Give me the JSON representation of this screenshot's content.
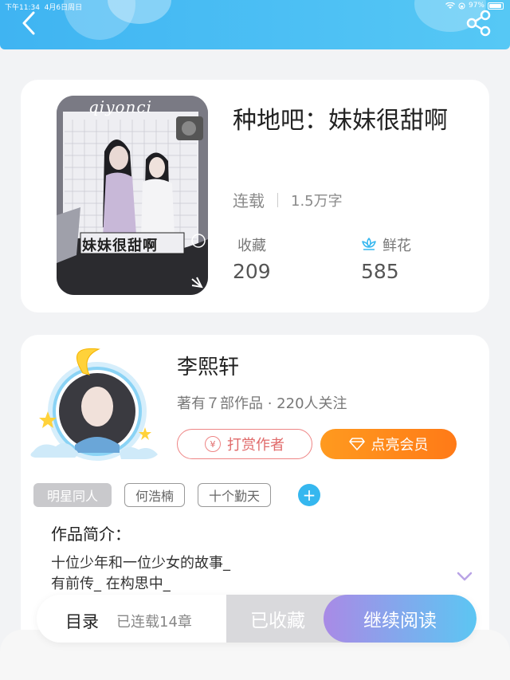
{
  "status_bar": {
    "time": "下午11:34",
    "date": "4月6日周日",
    "battery": "97%"
  },
  "header": {
    "back_icon": "chevron-left-icon",
    "share_icon": "share-icon"
  },
  "book": {
    "title": "种地吧：妹妹很甜啊",
    "status": "连载",
    "word_count": "1.5万字",
    "collect_label": "收藏",
    "collect_count": "209",
    "flower_label": "鲜花",
    "flower_count": "585",
    "cover_text": "妹妹很甜啊",
    "cover_script": "qiyonci"
  },
  "author": {
    "name": "李熙轩",
    "meta": "著有７部作品 · 220人关注",
    "reward_label": "打赏作者",
    "vip_label": "点亮会员"
  },
  "tags": [
    "明星同人",
    "何浩楠",
    "十个勤天"
  ],
  "intro": {
    "label": "作品简介：",
    "text": "十位少年和一位少女的故事_\n有前传_ 在构思中_"
  },
  "bottom_bar": {
    "toc_label": "目录",
    "serial_text": "已连载14章",
    "saved_label": "已收藏",
    "read_label": "继续阅读"
  },
  "colors": {
    "header": "#3fb4f2",
    "vip": "#ff8a1a",
    "reward": "#e06a6a",
    "tag_add": "#35b7ef"
  }
}
